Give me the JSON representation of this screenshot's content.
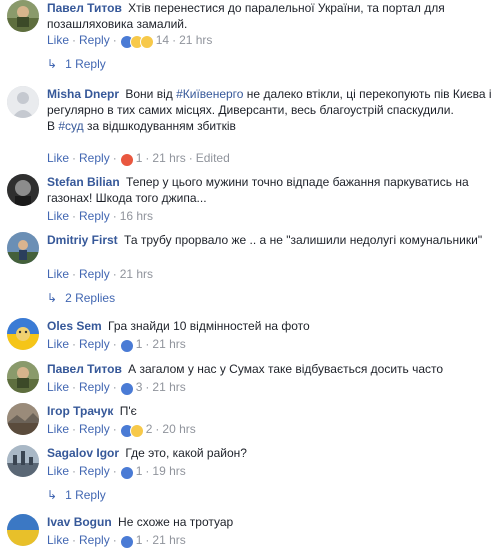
{
  "comments": [
    {
      "author": "Павел Титов",
      "text": "Хтів перенестися до паралельної України, та портал для позашляховика замалий.",
      "like": "Like",
      "reply": "Reply",
      "reactions": [
        "like-icon",
        "haha-icon",
        "wow-icon"
      ],
      "count": "14",
      "time": "21 hrs"
    },
    {
      "author": "Misha Dnepr",
      "text_a": "Вони від ",
      "hashtag1": "#Київенерго",
      "text_b": " не далеко втікли, ці перекопують пів Києва і регулярно в тих самих місцях. Диверсанти, весь благоустрій спаскудили.",
      "text_c": "В ",
      "hashtag2": "#суд",
      "text_d": " за відшкодуванням збитків",
      "like": "Like",
      "reply": "Reply",
      "reactions": [
        "angry-icon"
      ],
      "count": "1",
      "time": "21 hrs",
      "edited": "Edited"
    },
    {
      "author": "Stefan Bilian",
      "text": "Тепер у цього мужини точно відпаде бажання паркуватись на газонах! Шкода того джипа...",
      "like": "Like",
      "reply": "Reply",
      "time": "16 hrs"
    },
    {
      "author": "Dmitriy First",
      "text": "Та трубу прорвало же .. а не \"залишили недолугі комунальники\"",
      "like": "Like",
      "reply": "Reply",
      "time": "21 hrs"
    },
    {
      "author": "Oles Sem",
      "text": "Гра знайди 10 відмінностей на фото",
      "like": "Like",
      "reply": "Reply",
      "reactions": [
        "like-icon"
      ],
      "count": "1",
      "time": "21 hrs"
    },
    {
      "author": "Павел Титов",
      "text": "А загалом у нас у Сумах таке відбувається досить часто",
      "like": "Like",
      "reply": "Reply",
      "reactions": [
        "like-icon"
      ],
      "count": "3",
      "time": "21 hrs"
    },
    {
      "author": "Ігор Трачук",
      "text": "П'є",
      "like": "Like",
      "reply": "Reply",
      "reactions": [
        "like-icon",
        "haha-icon"
      ],
      "count": "2",
      "time": "20 hrs"
    },
    {
      "author": "Sagalov Igor",
      "text": "Где это, какой район?",
      "like": "Like",
      "reply": "Reply",
      "reactions": [
        "like-icon"
      ],
      "count": "1",
      "time": "19 hrs"
    },
    {
      "author": "Ivav Bogun",
      "text": "Не схоже на тротуар",
      "like": "Like",
      "reply": "Reply",
      "reactions": [
        "like-icon"
      ],
      "count": "1",
      "time": "21 hrs"
    }
  ],
  "reply_links": {
    "r1": "1 Reply",
    "r4": "2 Replies",
    "r8": "1 Reply"
  },
  "separator": "·",
  "colors": {
    "link": "#365899",
    "action": "#4267b2",
    "muted": "#90949c",
    "text": "#1d2129",
    "like": "#4a7bd5",
    "haha": "#f7c94a",
    "angry": "#e9573f"
  }
}
